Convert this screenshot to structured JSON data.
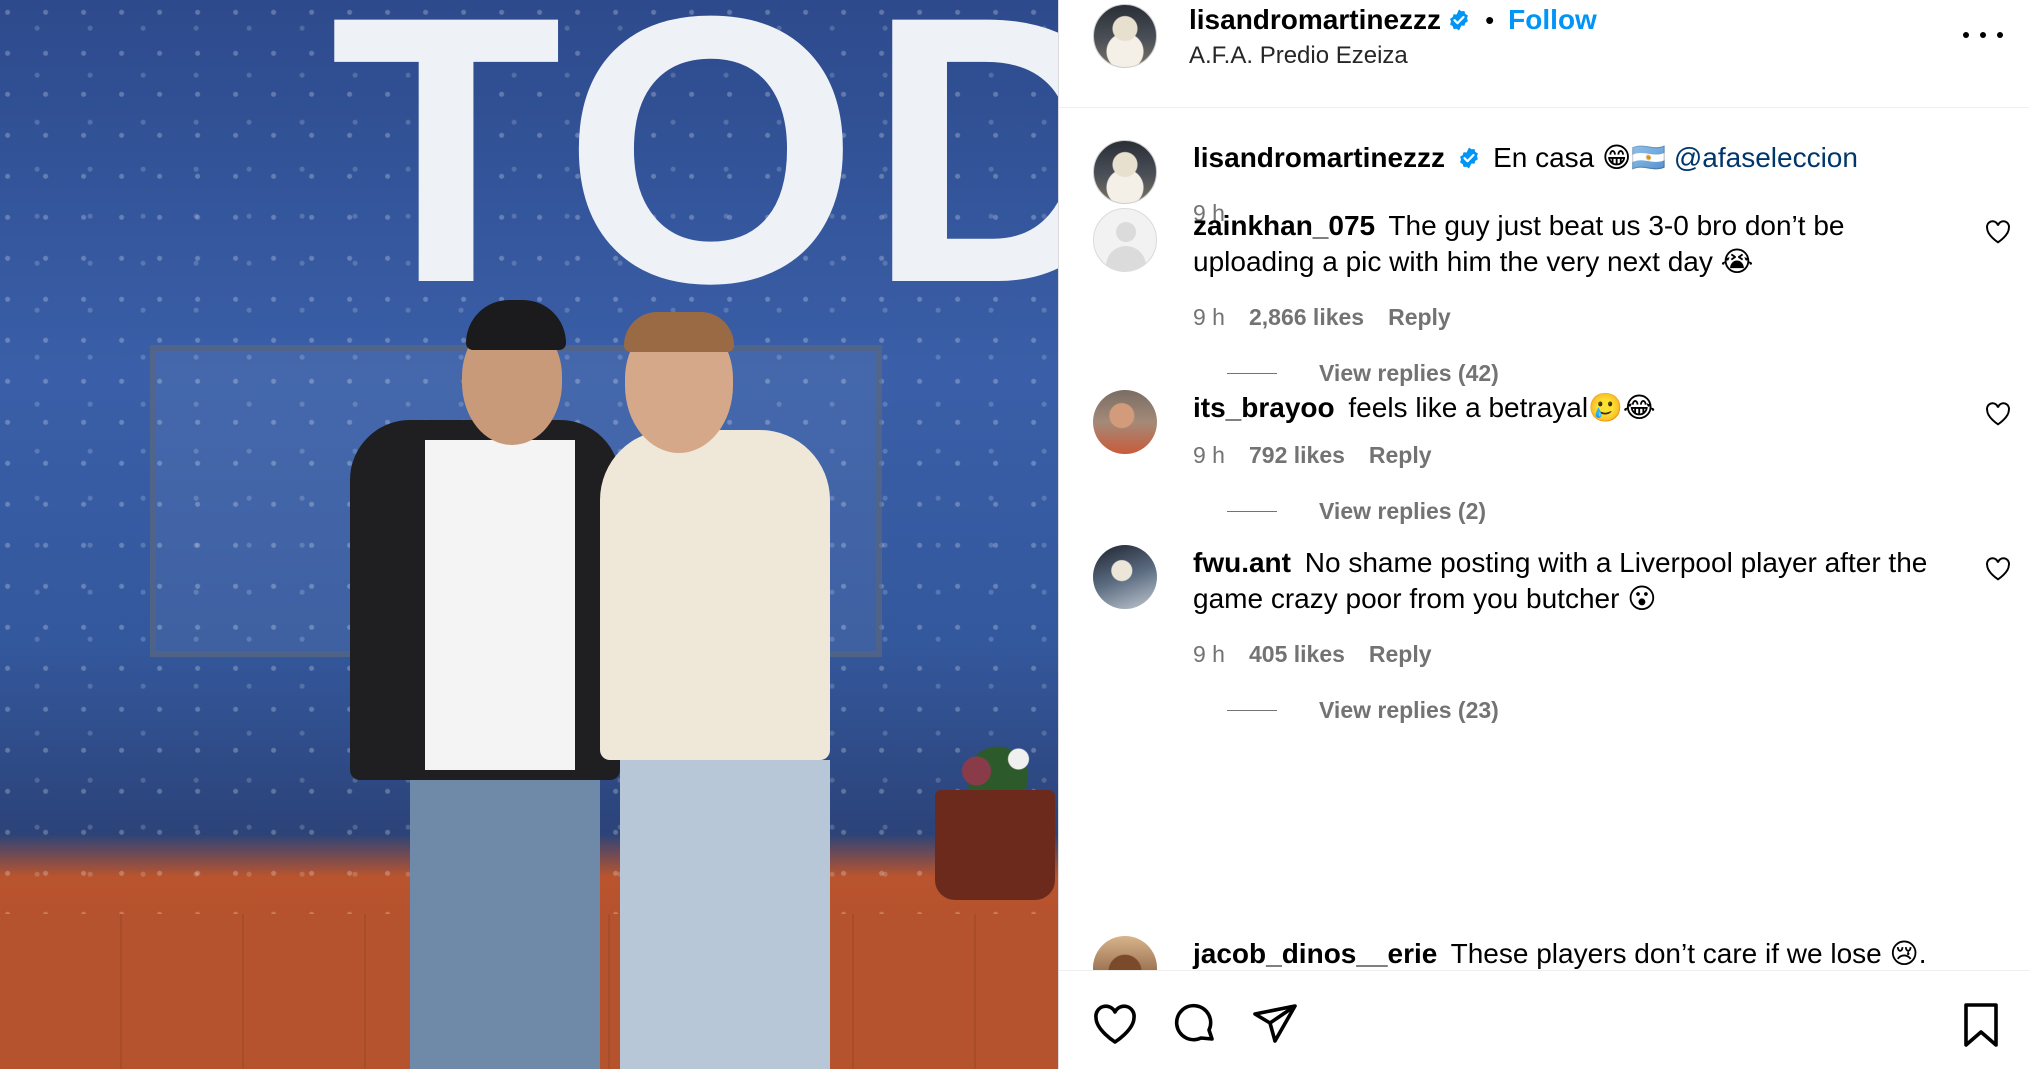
{
  "post": {
    "author": "lisandromartinezzz",
    "location": "A.F.A. Predio Ezeiza",
    "follow_label": "Follow",
    "separator": "•",
    "photo_text": "TODOS",
    "caption": {
      "text": "En casa 😁🇦🇷",
      "mention": "@afaseleccion",
      "time": "9 h"
    }
  },
  "comments": [
    {
      "username": "zainkhan_075",
      "text": "The guy just beat us 3-0 bro don’t be uploading a pic with him the very next day 😭",
      "time": "9 h",
      "likes": "2,866 likes",
      "reply": "Reply",
      "view_replies": "View replies (42)"
    },
    {
      "username": "its_brayoo",
      "text": "feels like a betrayal🥲😂",
      "time": "9 h",
      "likes": "792 likes",
      "reply": "Reply",
      "view_replies": "View replies (2)"
    },
    {
      "username": "fwu.ant",
      "text": "No shame posting with a Liverpool player after the game crazy poor from you butcher 😮",
      "time": "9 h",
      "likes": "405 likes",
      "reply": "Reply",
      "view_replies": "View replies (23)"
    },
    {
      "username": "jacob_dinos__erie",
      "text": "These players don’t care if we lose 😢."
    }
  ],
  "icons": {
    "like": "heart-icon",
    "comment": "comment-icon",
    "share": "share-icon",
    "save": "bookmark-icon",
    "more": "more-options-icon",
    "verified": "verified-badge-icon"
  },
  "colors": {
    "follow": "#0095f6",
    "mention": "#00376b",
    "secondary_text": "#737373",
    "verified": "#0095f6"
  }
}
